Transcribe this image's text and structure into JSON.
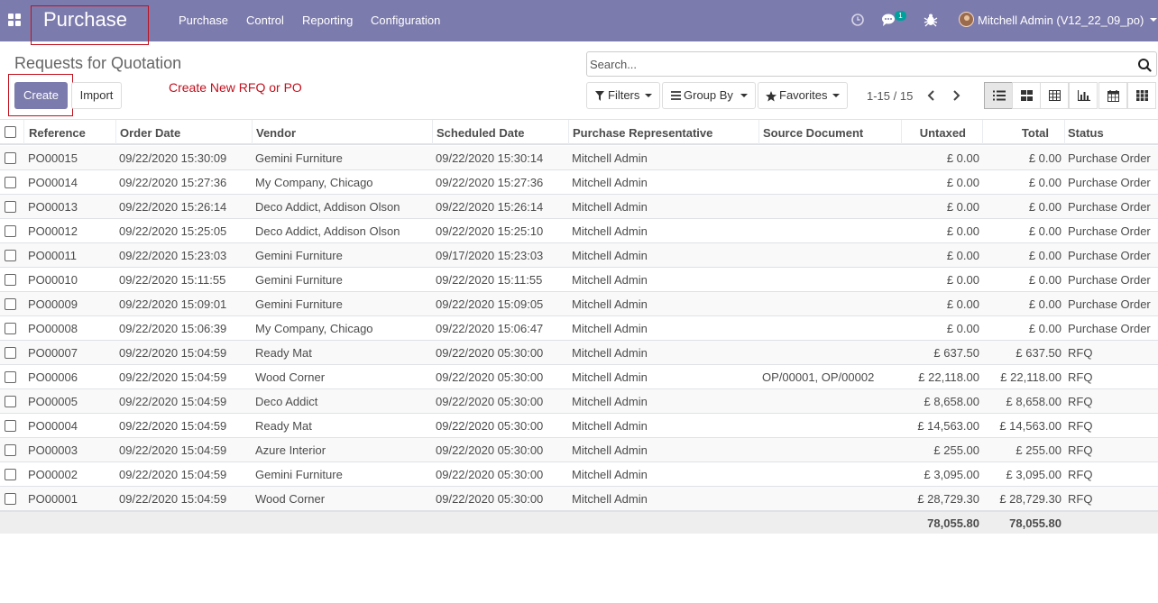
{
  "navbar": {
    "brand": "Purchase",
    "menu": [
      "Purchase",
      "Control",
      "Reporting",
      "Configuration"
    ],
    "chat_count": "1",
    "user": "Mitchell Admin (V12_22_09_po)"
  },
  "control_panel": {
    "title": "Requests for Quotation",
    "search_placeholder": "Search...",
    "create_label": "Create",
    "import_label": "Import",
    "annotation": "Create New RFQ or PO",
    "filters_label": "Filters",
    "groupby_label": "Group By",
    "favorites_label": "Favorites",
    "pager": "1-15 / 15",
    "views": [
      "list-view-icon",
      "kanban-view-icon",
      "pivot-view-icon",
      "graph-view-icon",
      "calendar-view-icon",
      "activity-view-icon"
    ],
    "active_view": "list-view-icon"
  },
  "table": {
    "headers": [
      "Reference",
      "Order Date",
      "Vendor",
      "Scheduled Date",
      "Purchase Representative",
      "Source Document",
      "Untaxed",
      "Total",
      "Status"
    ],
    "rows": [
      [
        "PO00015",
        "09/22/2020 15:30:09",
        "Gemini Furniture",
        "09/22/2020 15:30:14",
        "Mitchell Admin",
        "",
        "£ 0.00",
        "£ 0.00",
        "Purchase Order"
      ],
      [
        "PO00014",
        "09/22/2020 15:27:36",
        "My Company, Chicago",
        "09/22/2020 15:27:36",
        "Mitchell Admin",
        "",
        "£ 0.00",
        "£ 0.00",
        "Purchase Order"
      ],
      [
        "PO00013",
        "09/22/2020 15:26:14",
        "Deco Addict, Addison Olson",
        "09/22/2020 15:26:14",
        "Mitchell Admin",
        "",
        "£ 0.00",
        "£ 0.00",
        "Purchase Order"
      ],
      [
        "PO00012",
        "09/22/2020 15:25:05",
        "Deco Addict, Addison Olson",
        "09/22/2020 15:25:10",
        "Mitchell Admin",
        "",
        "£ 0.00",
        "£ 0.00",
        "Purchase Order"
      ],
      [
        "PO00011",
        "09/22/2020 15:23:03",
        "Gemini Furniture",
        "09/17/2020 15:23:03",
        "Mitchell Admin",
        "",
        "£ 0.00",
        "£ 0.00",
        "Purchase Order"
      ],
      [
        "PO00010",
        "09/22/2020 15:11:55",
        "Gemini Furniture",
        "09/22/2020 15:11:55",
        "Mitchell Admin",
        "",
        "£ 0.00",
        "£ 0.00",
        "Purchase Order"
      ],
      [
        "PO00009",
        "09/22/2020 15:09:01",
        "Gemini Furniture",
        "09/22/2020 15:09:05",
        "Mitchell Admin",
        "",
        "£ 0.00",
        "£ 0.00",
        "Purchase Order"
      ],
      [
        "PO00008",
        "09/22/2020 15:06:39",
        "My Company, Chicago",
        "09/22/2020 15:06:47",
        "Mitchell Admin",
        "",
        "£ 0.00",
        "£ 0.00",
        "Purchase Order"
      ],
      [
        "PO00007",
        "09/22/2020 15:04:59",
        "Ready Mat",
        "09/22/2020 05:30:00",
        "Mitchell Admin",
        "",
        "£ 637.50",
        "£ 637.50",
        "RFQ"
      ],
      [
        "PO00006",
        "09/22/2020 15:04:59",
        "Wood Corner",
        "09/22/2020 05:30:00",
        "Mitchell Admin",
        "OP/00001, OP/00002",
        "£ 22,118.00",
        "£ 22,118.00",
        "RFQ"
      ],
      [
        "PO00005",
        "09/22/2020 15:04:59",
        "Deco Addict",
        "09/22/2020 05:30:00",
        "Mitchell Admin",
        "",
        "£ 8,658.00",
        "£ 8,658.00",
        "RFQ"
      ],
      [
        "PO00004",
        "09/22/2020 15:04:59",
        "Ready Mat",
        "09/22/2020 05:30:00",
        "Mitchell Admin",
        "",
        "£ 14,563.00",
        "£ 14,563.00",
        "RFQ"
      ],
      [
        "PO00003",
        "09/22/2020 15:04:59",
        "Azure Interior",
        "09/22/2020 05:30:00",
        "Mitchell Admin",
        "",
        "£ 255.00",
        "£ 255.00",
        "RFQ"
      ],
      [
        "PO00002",
        "09/22/2020 15:04:59",
        "Gemini Furniture",
        "09/22/2020 05:30:00",
        "Mitchell Admin",
        "",
        "£ 3,095.00",
        "£ 3,095.00",
        "RFQ"
      ],
      [
        "PO00001",
        "09/22/2020 15:04:59",
        "Wood Corner",
        "09/22/2020 05:30:00",
        "Mitchell Admin",
        "",
        "£ 28,729.30",
        "£ 28,729.30",
        "RFQ"
      ]
    ],
    "totals": {
      "untaxed": "78,055.80",
      "total": "78,055.80"
    }
  },
  "colors": {
    "navbar": "#7c7bad",
    "annotation": "#c0101d",
    "badge": "#00a09d"
  }
}
